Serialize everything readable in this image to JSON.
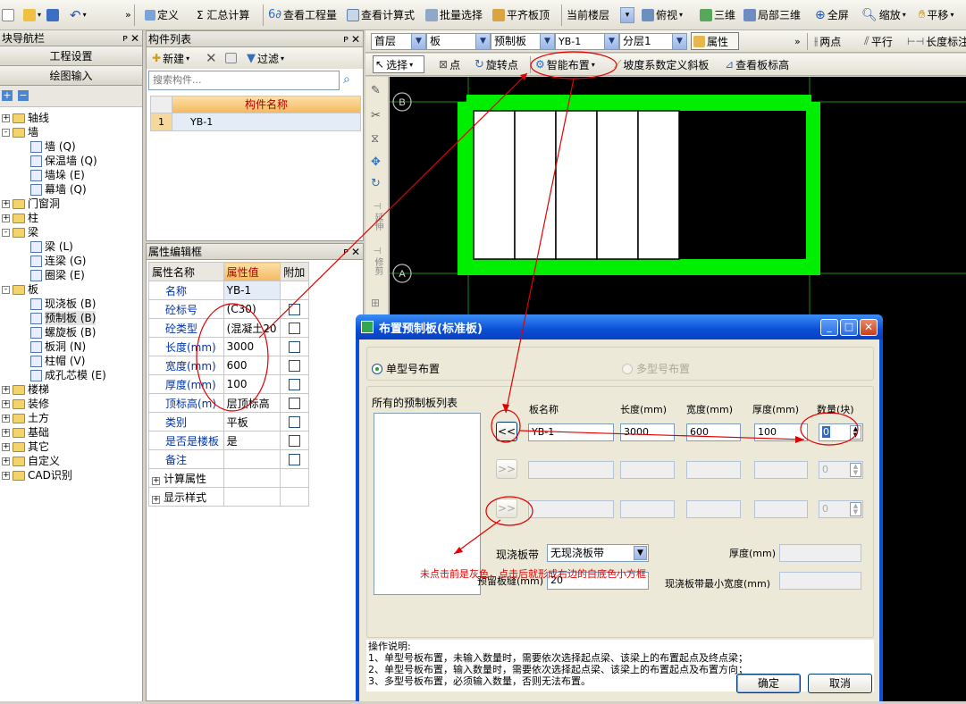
{
  "top_toolbar": {
    "define": "定义",
    "summary": "Σ 汇总计算",
    "view_quantity": "查看工程量",
    "view_formula": "查看计算式",
    "batch_select": "批量选择",
    "flat_roof": "平齐板顶",
    "current_floor": "当前楼层",
    "view_mode": "俯视",
    "three_d": "三维",
    "local_three_d": "局部三维",
    "fullscreen": "全屏",
    "zoom": "缩放",
    "pan": "平移"
  },
  "nav_panel": {
    "title": "块导航栏",
    "project_settings": "工程设置",
    "drawing_input": "绘图输入",
    "tree": [
      {
        "label": "轴线",
        "level": 0,
        "sign": "+"
      },
      {
        "label": "墙",
        "level": 0,
        "sign": "-"
      },
      {
        "label": "墙 (Q)",
        "level": 1
      },
      {
        "label": "保温墙 (Q)",
        "level": 1
      },
      {
        "label": "墙垛 (E)",
        "level": 1
      },
      {
        "label": "幕墙 (Q)",
        "level": 1
      },
      {
        "label": "门窗洞",
        "level": 0,
        "sign": "+"
      },
      {
        "label": "柱",
        "level": 0,
        "sign": "+"
      },
      {
        "label": "梁",
        "level": 0,
        "sign": "-"
      },
      {
        "label": "梁 (L)",
        "level": 1
      },
      {
        "label": "连梁 (G)",
        "level": 1
      },
      {
        "label": "圈梁 (E)",
        "level": 1
      },
      {
        "label": "板",
        "level": 0,
        "sign": "-"
      },
      {
        "label": "现浇板 (B)",
        "level": 1
      },
      {
        "label": "预制板 (B)",
        "level": 1
      },
      {
        "label": "螺旋板 (B)",
        "level": 1
      },
      {
        "label": "板洞 (N)",
        "level": 1
      },
      {
        "label": "柱帽 (V)",
        "level": 1
      },
      {
        "label": "成孔芯模 (E)",
        "level": 1
      },
      {
        "label": "楼梯",
        "level": 0,
        "sign": "+"
      },
      {
        "label": "装修",
        "level": 0,
        "sign": "+"
      },
      {
        "label": "土方",
        "level": 0,
        "sign": "+"
      },
      {
        "label": "基础",
        "level": 0,
        "sign": "+"
      },
      {
        "label": "其它",
        "level": 0,
        "sign": "+"
      },
      {
        "label": "自定义",
        "level": 0,
        "sign": "+"
      },
      {
        "label": "CAD识别",
        "level": 0,
        "sign": "+"
      }
    ]
  },
  "component_list": {
    "title": "构件列表",
    "new_btn": "新建",
    "filter_btn": "过滤",
    "search_placeholder": "搜索构件...",
    "column_header": "构件名称",
    "rows": [
      {
        "index": "1",
        "name": "YB-1"
      }
    ]
  },
  "property_editor": {
    "title": "属性编辑框",
    "headers": [
      "属性名称",
      "属性值",
      "附加"
    ],
    "rows": [
      {
        "name": "名称",
        "value": "YB-1",
        "check": false
      },
      {
        "name": "砼标号",
        "value": "(C30)",
        "check": true
      },
      {
        "name": "砼类型",
        "value": "(混凝土20",
        "check": true
      },
      {
        "name": "长度(mm)",
        "value": "3000",
        "check": true
      },
      {
        "name": "宽度(mm)",
        "value": "600",
        "check": true
      },
      {
        "name": "厚度(mm)",
        "value": "100",
        "check": true
      },
      {
        "name": "顶标高(m)",
        "value": "层顶标高",
        "check": true
      },
      {
        "name": "类别",
        "value": "平板",
        "check": true
      },
      {
        "name": "是否是楼板",
        "value": "是",
        "check": true
      },
      {
        "name": "备注",
        "value": "",
        "check": true
      }
    ],
    "expanders": [
      "计算属性",
      "显示样式"
    ]
  },
  "drawing_toolbar": {
    "floor": "首层",
    "type": "板",
    "subtype": "预制板",
    "component": "YB-1",
    "layer": "分层1",
    "properties_btn": "属性",
    "two_points": "两点",
    "parallel": "平行",
    "length_label": "长度标注",
    "select": "选择",
    "point": "点",
    "rotate_point": "旋转点",
    "smart_layout": "智能布置",
    "slope_define": "坡度系数定义斜板",
    "view_elevation": "查看板标高"
  },
  "side_tools": [
    "延伸",
    "修剪"
  ],
  "canvas": {
    "axis_labels": [
      "B",
      "A"
    ],
    "panel_count": 5
  },
  "dialog": {
    "title": "布置预制板(标准板)",
    "single_type": "单型号布置",
    "multi_type": "多型号布置",
    "list_label": "所有的预制板列表",
    "col_name": "板名称",
    "col_length": "长度(mm)",
    "col_width": "宽度(mm)",
    "col_thickness": "厚度(mm)",
    "col_count": "数量(块)",
    "row1": {
      "name": "YB-1",
      "length": "3000",
      "width": "600",
      "thickness": "100",
      "count": "0"
    },
    "row2_count": "0",
    "row3_count": "0",
    "btn_left": "<<",
    "btn_right": ">>",
    "strip_label": "现浇板带",
    "strip_value": "无现浇板带",
    "thickness_label": "厚度(mm)",
    "gap_label": "预留板缝(mm)",
    "gap_value": "20",
    "min_width_label": "现浇板带最小宽度(mm)",
    "instructions_title": "操作说明:",
    "instructions": [
      "1、单型号板布置，未输入数量时，需要依次选择起点梁、该梁上的布置起点及终点梁；",
      "2、单型号板布置，输入数量时，需要依次选择起点梁、该梁上的布置起点及布置方向；",
      "3、多型号板布置，必须输入数量，否则无法布置。"
    ],
    "ok": "确定",
    "cancel": "取消",
    "annotation": "未点击前是灰色，点击后就形成右边的白底色小方框"
  },
  "colors": {
    "canvas_bg": "#000000",
    "slab_green": "#00ee00",
    "annotation_red": "#e00000",
    "xp_title": "#0a4fd6",
    "header_orange": "#f7c37a"
  }
}
